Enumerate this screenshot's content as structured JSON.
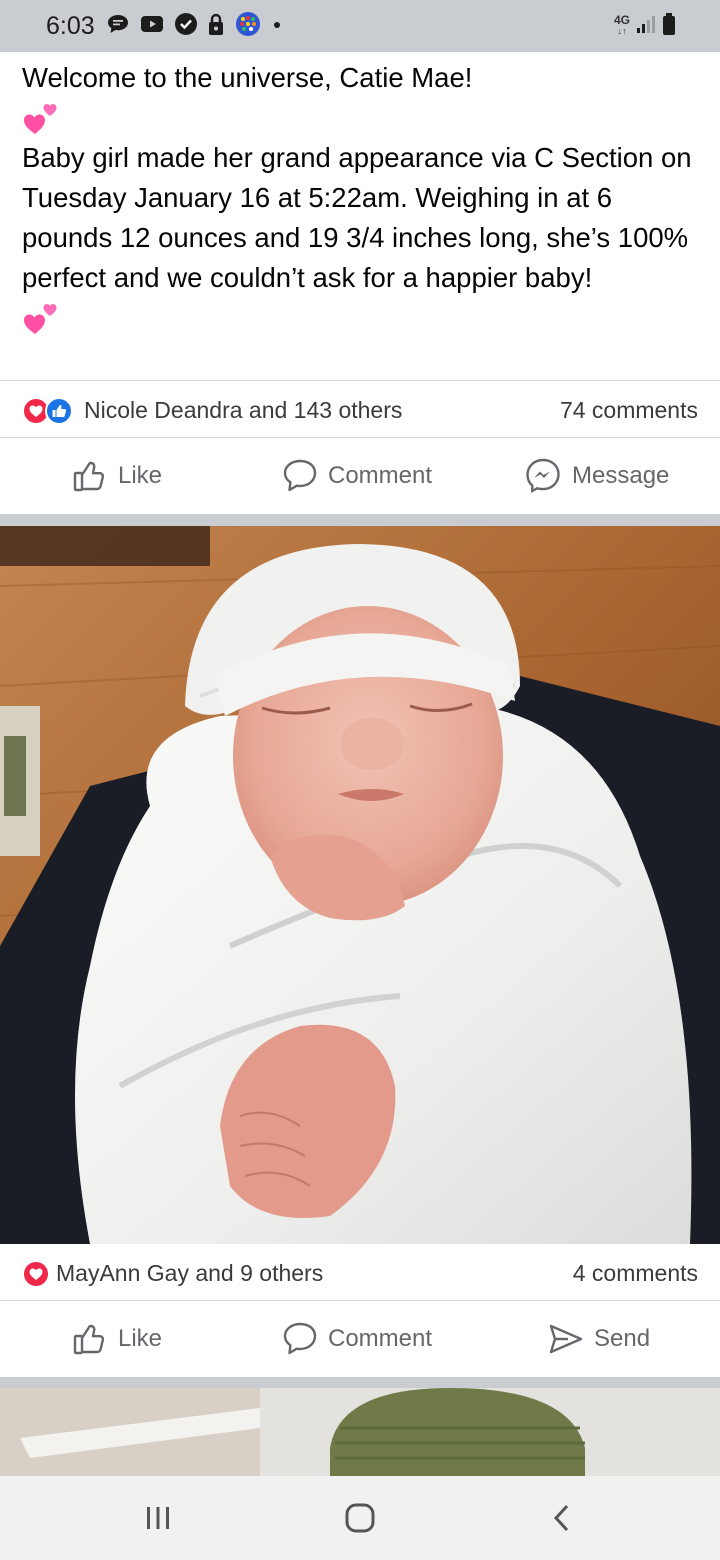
{
  "status_bar": {
    "time": "6:03",
    "network": "4G",
    "icons": [
      "messages-icon",
      "video-icon",
      "check-badge-icon",
      "lock-icon",
      "game-icon",
      "dot-icon",
      "signal-icon",
      "battery-icon"
    ]
  },
  "post1": {
    "text_line1": "Welcome to the universe, Catie Mae!",
    "emoji": "two-hearts",
    "text_body": "Baby girl made her grand appearance via C Section on Tuesday January 16 at 5:22am. Weighing in at 6 pounds 12 ounces and 19 3/4 inches long, she’s 100% perfect and we couldn’t ask for a happier baby!",
    "reactions": {
      "icons": [
        "love-reaction-icon",
        "like-reaction-icon"
      ],
      "names": "Nicole Deandra and 143 others",
      "comments": "74 comments"
    },
    "actions": {
      "like": "Like",
      "comment": "Comment",
      "message": "Message"
    }
  },
  "post2": {
    "image": "newborn-baby-photo",
    "reactions": {
      "icons": [
        "love-reaction-icon"
      ],
      "names": "MayAnn Gay and 9 others",
      "comments": "4 comments"
    },
    "actions": {
      "like": "Like",
      "comment": "Comment",
      "send": "Send"
    }
  },
  "nav_bar": {
    "buttons": [
      "recents-icon",
      "home-icon",
      "back-icon"
    ]
  },
  "colors": {
    "status_bar_bg": "#c9ccd1",
    "text_primary": "#050505",
    "text_secondary": "#65676b",
    "love_red": "#f0284a",
    "like_blue": "#1b74e4",
    "divider": "#d6d8dc"
  }
}
